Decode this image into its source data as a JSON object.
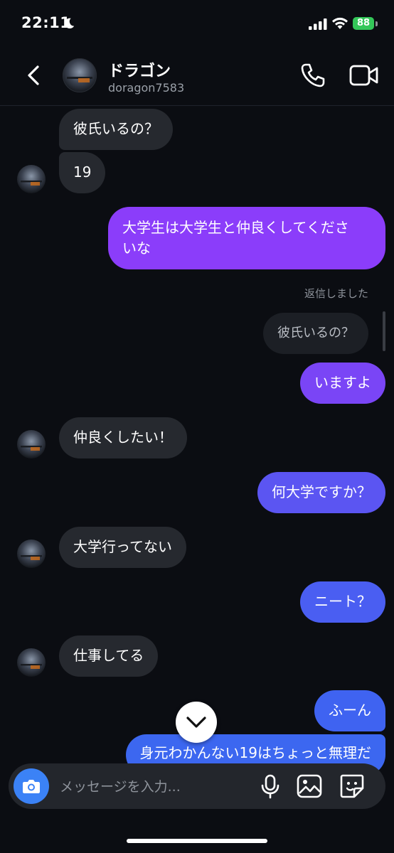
{
  "status_bar": {
    "time": "22:11",
    "battery": "88"
  },
  "header": {
    "name": "ドラゴン",
    "username": "doragon7583"
  },
  "messages": [
    {
      "direction": "incoming",
      "text": "彼氏いるの？"
    },
    {
      "direction": "incoming",
      "text": "19"
    },
    {
      "direction": "outgoing",
      "text_line1": "大学生は大学生と仲良くしてくださ",
      "text_line2": "いな"
    },
    {
      "direction": "outgoing",
      "text": "いますよ"
    },
    {
      "direction": "incoming",
      "text": "仲良くしたい！"
    },
    {
      "direction": "outgoing",
      "text": "何大学ですか？"
    },
    {
      "direction": "incoming",
      "text": "大学行ってない"
    },
    {
      "direction": "outgoing",
      "text": "ニート？"
    },
    {
      "direction": "incoming",
      "text": "仕事してる"
    },
    {
      "direction": "outgoing",
      "text": "ふーん"
    },
    {
      "direction": "outgoing",
      "text": "身元わかんない19はちょっと無理だ"
    }
  ],
  "reply": {
    "note": "返信しました",
    "quoted": "彼氏いるの？"
  },
  "composer": {
    "placeholder": "メッセージを入力..."
  },
  "colors": {
    "background": "#0b0d12",
    "incoming_bubble": "#26292f",
    "outgoing_purple": "#8b3dfa",
    "outgoing_blue": "#3c67f0",
    "accent_blue": "#3b82f6"
  }
}
